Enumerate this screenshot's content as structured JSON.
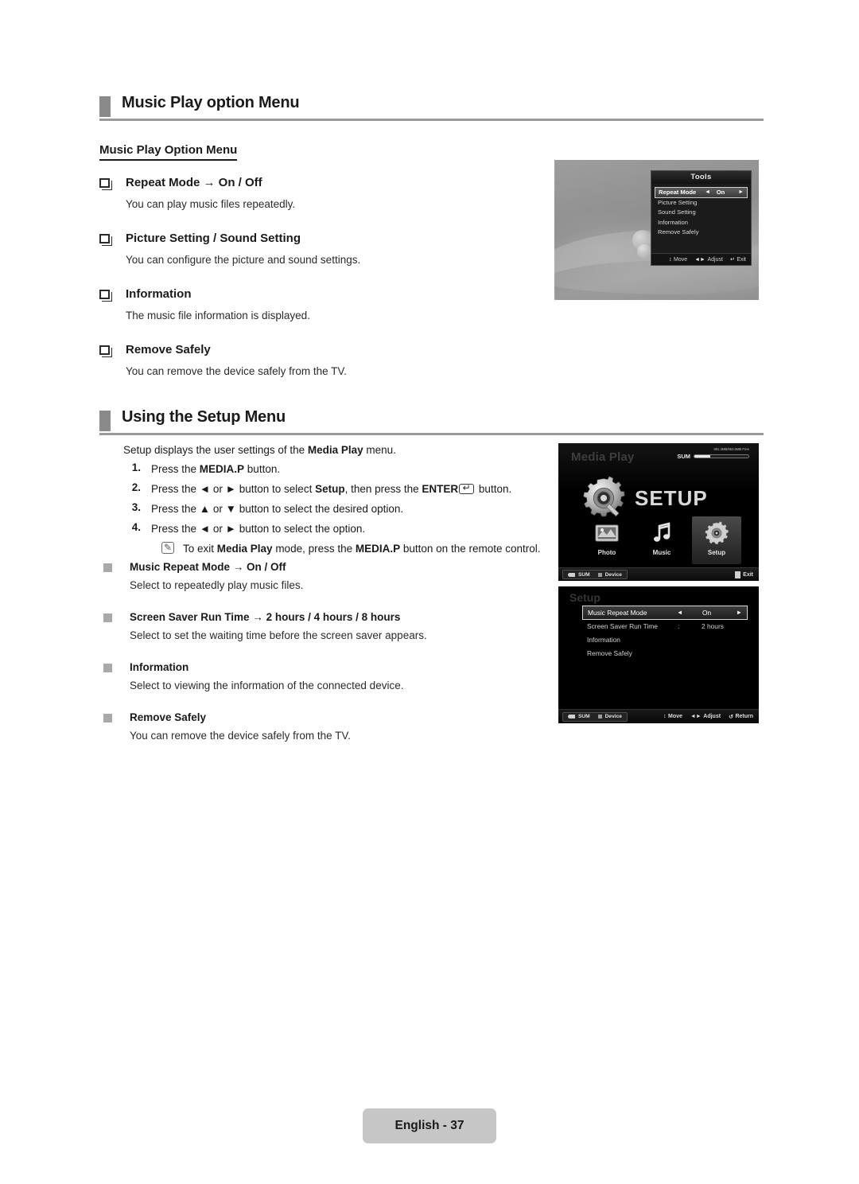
{
  "sections": {
    "music_play_option": {
      "heading": "Music Play option Menu",
      "subheading": "Music Play Option Menu",
      "items": [
        {
          "title": "Repeat Mode → On / Off",
          "desc": "You can play music files repeatedly."
        },
        {
          "title": "Picture Setting / Sound Setting",
          "desc": "You can configure the picture and sound settings."
        },
        {
          "title": "Information",
          "desc": "The music file information is displayed."
        },
        {
          "title": "Remove Safely",
          "desc": "You can remove the device safely from the TV."
        }
      ]
    },
    "using_setup": {
      "heading": "Using the Setup Menu",
      "intro_pre": "Setup displays the user settings of the ",
      "intro_bold": "Media Play",
      "intro_post": " menu.",
      "steps": [
        {
          "num": "1.",
          "pre": "Press the ",
          "bold": "MEDIA.P",
          "post": " button."
        },
        {
          "num": "2.",
          "pre": "Press the ◄ or ► button to select ",
          "bold": "Setup",
          "mid": ", then press the ",
          "bold2": "ENTER",
          "post": " button."
        },
        {
          "num": "3.",
          "pre": "Press the ▲ or ▼ button to select the desired option.",
          "bold": "",
          "post": ""
        },
        {
          "num": "4.",
          "pre": "Press the ◄ or ► button to select the option.",
          "bold": "",
          "post": ""
        }
      ],
      "note": {
        "pre": "To exit ",
        "bold": "Media Play",
        "mid": " mode, press the ",
        "bold2": "MEDIA.P",
        "post": " button on the remote control."
      },
      "items": [
        {
          "title": "Music Repeat Mode → On / Off",
          "desc": "Select to repeatedly play music files."
        },
        {
          "title": "Screen Saver Run Time → 2 hours / 4 hours / 8 hours",
          "desc": "Select to set the waiting time before the screen saver appears."
        },
        {
          "title": "Information",
          "desc": "Select to viewing the information of the connected device."
        },
        {
          "title": "Remove Safely",
          "desc": "You can remove the device safely from the TV."
        }
      ]
    }
  },
  "tools_screen": {
    "title": "Tools",
    "rows": [
      {
        "label": "Repeat Mode",
        "left": "◄",
        "value": "On",
        "right": "►",
        "selected": true
      },
      {
        "label": "Picture Setting",
        "selected": false
      },
      {
        "label": "Sound Setting",
        "selected": false
      },
      {
        "label": "Information",
        "selected": false
      },
      {
        "label": "Remove Safely",
        "selected": false
      }
    ],
    "footer": [
      {
        "icon": "↕",
        "label": "Move"
      },
      {
        "icon": "◄►",
        "label": "Adjust"
      },
      {
        "icon": "↵",
        "label": "Exit"
      }
    ]
  },
  "media_play_screen": {
    "title": "Media Play",
    "sum_label": "SUM",
    "capacity": "851.3MB/963.6MB Free",
    "hero_word": "SETUP",
    "icons": [
      {
        "name": "Photo",
        "active": false
      },
      {
        "name": "Music",
        "active": false
      },
      {
        "name": "Setup",
        "active": true
      }
    ],
    "footer_left": [
      {
        "label": "SUM",
        "icon": "usb-icon"
      },
      {
        "label": "Device",
        "icon": "square-icon"
      }
    ],
    "footer_right": {
      "label": "Exit"
    }
  },
  "setup_screen": {
    "title": "Setup",
    "rows": [
      {
        "label": "Music Repeat Mode",
        "left": "◄",
        "value": "On",
        "right": "►",
        "selected": true
      },
      {
        "label": "Screen Saver Run Time",
        "colon": ":",
        "value": "2 hours",
        "selected": false
      },
      {
        "label": "Information",
        "selected": false
      },
      {
        "label": "Remove Safely",
        "selected": false
      }
    ],
    "footer_left": [
      {
        "label": "SUM",
        "icon": "usb-icon"
      },
      {
        "label": "Device",
        "icon": "square-icon"
      }
    ],
    "footer_right": [
      {
        "icon": "↕",
        "label": "Move"
      },
      {
        "icon": "◄►",
        "label": "Adjust"
      },
      {
        "icon": "↺",
        "label": "Return"
      }
    ]
  },
  "page_footer": {
    "label": "English - 37"
  }
}
